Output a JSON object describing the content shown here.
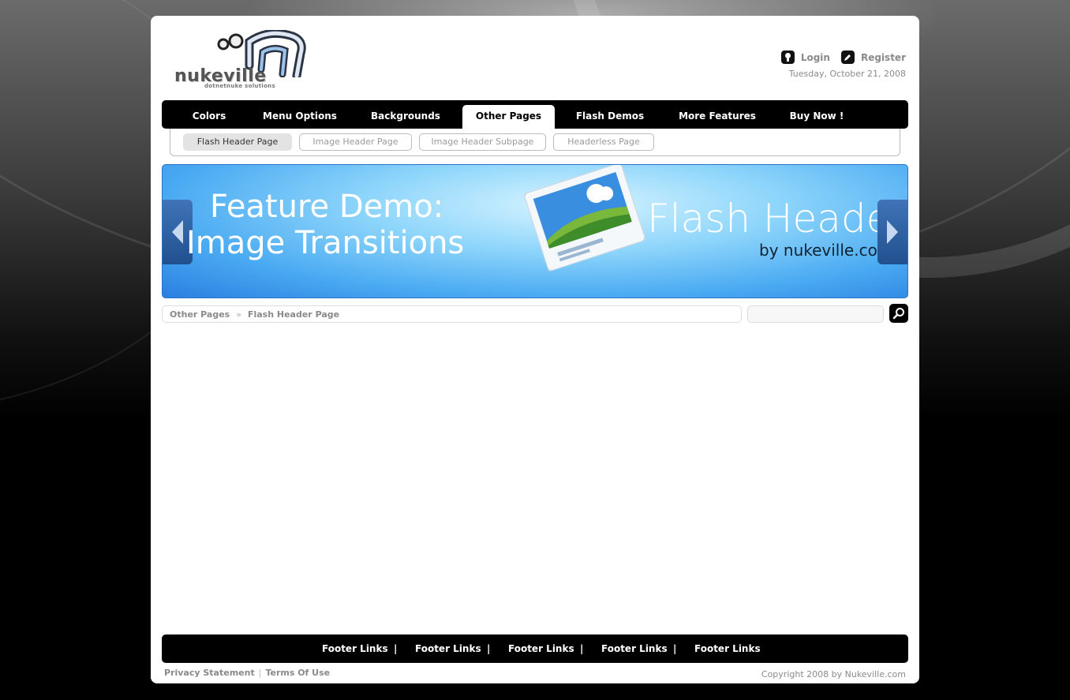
{
  "header": {
    "logo_text": "nukeville",
    "logo_subtext": "dotnetnuke solutions",
    "login_label": "Login",
    "register_label": "Register",
    "date": "Tuesday, October 21, 2008"
  },
  "menu": {
    "items": [
      {
        "label": "Colors"
      },
      {
        "label": "Menu Options"
      },
      {
        "label": "Backgrounds"
      },
      {
        "label": "Other Pages",
        "active": true
      },
      {
        "label": "Flash Demos"
      },
      {
        "label": "More Features"
      },
      {
        "label": "Buy Now !"
      }
    ]
  },
  "submenu": {
    "items": [
      {
        "label": "Flash Header Page",
        "active": true
      },
      {
        "label": "Image Header Page"
      },
      {
        "label": "Image Header Subpage"
      },
      {
        "label": "Headerless Page"
      }
    ]
  },
  "banner": {
    "line1": "Feature Demo:",
    "line2": "Image Transitions",
    "title": "Flash Header",
    "byline": "by nukeville.com"
  },
  "breadcrumb": {
    "parent": "Other Pages",
    "separator": "»",
    "current": "Flash Header Page"
  },
  "search": {
    "value": "",
    "button_icon": "search-icon"
  },
  "footer": {
    "links": [
      "Footer Links",
      "Footer Links",
      "Footer Links",
      "Footer Links",
      "Footer Links"
    ],
    "divider": "|",
    "privacy_label": "Privacy Statement",
    "bottom_divider": "|",
    "terms_label": "Terms Of Use",
    "copyright": "Copyright 2008 by Nukeville.com"
  },
  "colors": {
    "menu_bg": "#000000",
    "banner_blue": "#4aaaf2",
    "muted_text": "#8a8a8a"
  }
}
